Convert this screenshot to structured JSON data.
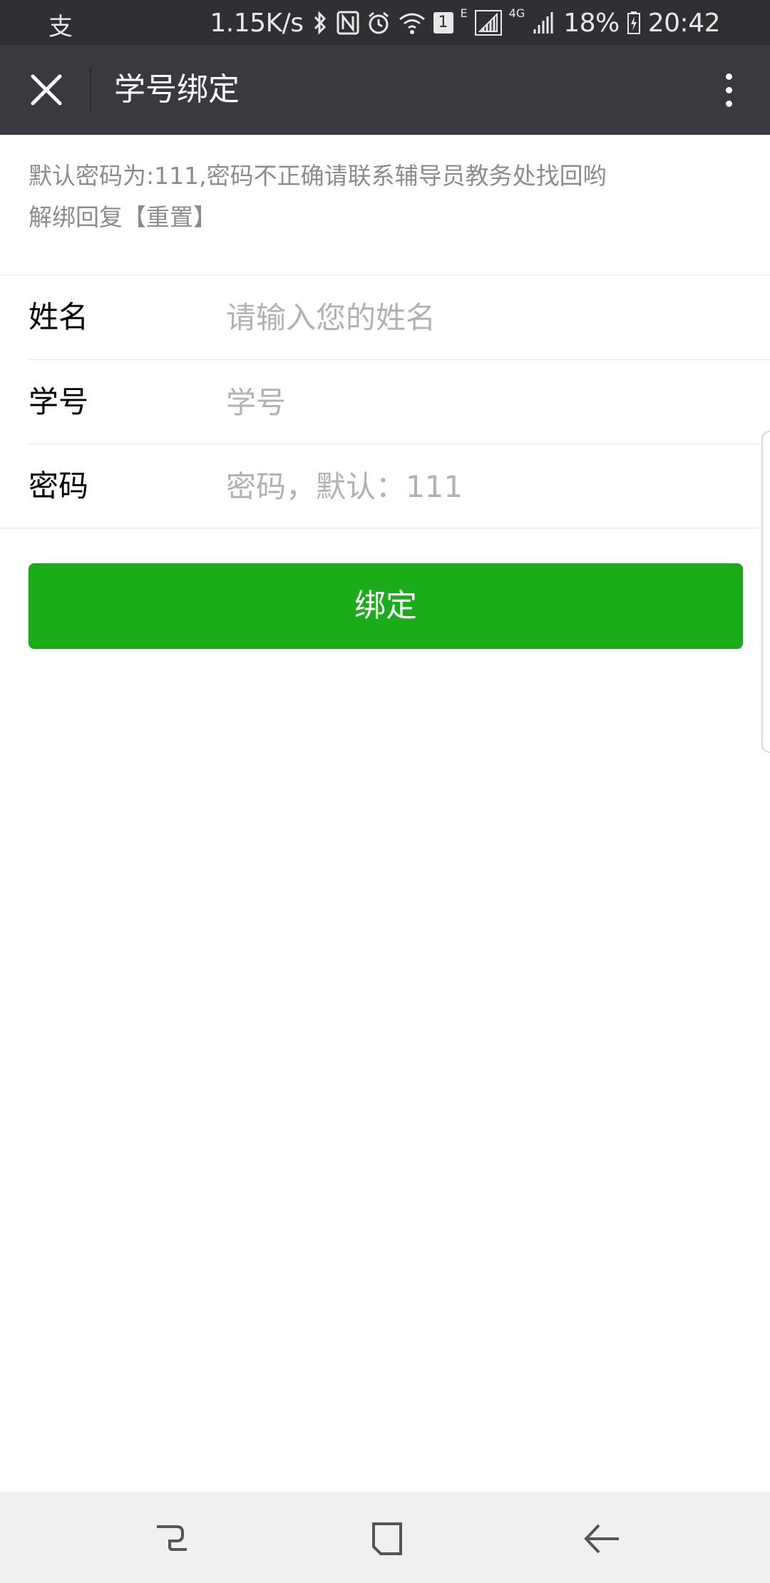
{
  "status_bar": {
    "app_icon_text": "支",
    "net_speed": "1.15K/s",
    "sim_badge": "1",
    "network_e": "E",
    "network_4g": "4G",
    "battery": "18%",
    "time": "20:42"
  },
  "header": {
    "title": "学号绑定"
  },
  "notice": {
    "line1": "默认密码为:111,密码不正确请联系辅导员教务处找回哟",
    "line2": "解绑回复【重置】"
  },
  "form": {
    "name": {
      "label": "姓名",
      "placeholder": "请输入您的姓名",
      "value": ""
    },
    "student_id": {
      "label": "学号",
      "placeholder": "学号",
      "value": ""
    },
    "password": {
      "label": "密码",
      "placeholder": "密码，默认：111",
      "value": ""
    }
  },
  "bind_button": {
    "label": "绑定"
  },
  "colors": {
    "status_bar_bg": "#2e3033",
    "title_bar_bg": "#393a3f",
    "primary_button": "#1aad19",
    "nav_bar_bg": "#f0f0f0"
  },
  "icons": {
    "close": "close-icon",
    "more": "more-vertical-icon",
    "nav_recent": "recent-apps-icon",
    "nav_home": "home-icon",
    "nav_back": "back-icon"
  }
}
